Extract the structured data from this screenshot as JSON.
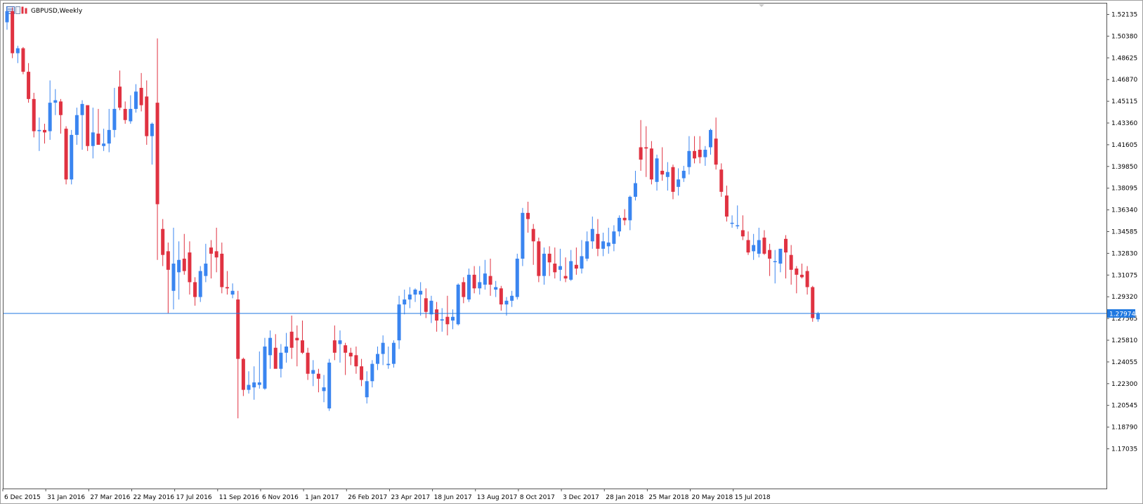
{
  "window": {
    "symbol_title": "GBPUSD,Weekly",
    "icons": [
      "chart-type-icon",
      "indicator-icon",
      "candle-icon"
    ]
  },
  "colors": {
    "bull": "#3a85f0",
    "bear": "#e03241",
    "current_price_line": "#1f78e0",
    "current_price_label_bg": "#1f78e0",
    "frame": "#888888"
  },
  "chart_data": {
    "type": "candlestick",
    "symbol": "GBPUSD",
    "timeframe": "Weekly",
    "current_price": 1.27974,
    "current_price_label": "1.27974",
    "ylim": [
      1.163,
      1.528
    ],
    "y_ticks": [
      "1.52135",
      "1.50380",
      "1.48625",
      "1.46870",
      "1.45115",
      "1.43360",
      "1.41605",
      "1.39850",
      "1.38095",
      "1.36340",
      "1.34585",
      "1.32830",
      "1.31075",
      "1.29320",
      "1.27565",
      "1.25810",
      "1.24055",
      "1.22300",
      "1.20545",
      "1.18790",
      "1.17035"
    ],
    "x_ticks": [
      {
        "index": 0,
        "label": "6 Dec 2015"
      },
      {
        "index": 8,
        "label": "31 Jan 2016"
      },
      {
        "index": 16,
        "label": "27 Mar 2016"
      },
      {
        "index": 24,
        "label": "22 May 2016"
      },
      {
        "index": 32,
        "label": "17 Jul 2016"
      },
      {
        "index": 40,
        "label": "11 Sep 2016"
      },
      {
        "index": 48,
        "label": "6 Nov 2016"
      },
      {
        "index": 56,
        "label": "1 Jan 2017"
      },
      {
        "index": 64,
        "label": "26 Feb 2017"
      },
      {
        "index": 72,
        "label": "23 Apr 2017"
      },
      {
        "index": 80,
        "label": "18 Jun 2017"
      },
      {
        "index": 88,
        "label": "13 Aug 2017"
      },
      {
        "index": 96,
        "label": "8 Oct 2017"
      },
      {
        "index": 104,
        "label": "3 Dec 2017"
      },
      {
        "index": 112,
        "label": "28 Jan 2018"
      },
      {
        "index": 120,
        "label": "25 Mar 2018"
      },
      {
        "index": 128,
        "label": "20 May 2018"
      },
      {
        "index": 136,
        "label": "15 Jul 2018"
      }
    ],
    "candles": [
      [
        1.515,
        1.528,
        1.509,
        1.524
      ],
      [
        1.524,
        1.527,
        1.486,
        1.49
      ],
      [
        1.49,
        1.496,
        1.482,
        1.494
      ],
      [
        1.494,
        1.495,
        1.473,
        1.475
      ],
      [
        1.475,
        1.482,
        1.45,
        1.453
      ],
      [
        1.453,
        1.458,
        1.422,
        1.427
      ],
      [
        1.427,
        1.438,
        1.411,
        1.428
      ],
      [
        1.428,
        1.433,
        1.417,
        1.426
      ],
      [
        1.427,
        1.468,
        1.42,
        1.45
      ],
      [
        1.45,
        1.461,
        1.44,
        1.452
      ],
      [
        1.451,
        1.453,
        1.425,
        1.44
      ],
      [
        1.429,
        1.431,
        1.384,
        1.388
      ],
      [
        1.388,
        1.428,
        1.384,
        1.424
      ],
      [
        1.424,
        1.446,
        1.416,
        1.44
      ],
      [
        1.44,
        1.452,
        1.412,
        1.449
      ],
      [
        1.448,
        1.448,
        1.411,
        1.415
      ],
      [
        1.415,
        1.446,
        1.405,
        1.426
      ],
      [
        1.425,
        1.445,
        1.417,
        1.416
      ],
      [
        1.415,
        1.429,
        1.411,
        1.417
      ],
      [
        1.417,
        1.445,
        1.41,
        1.428
      ],
      [
        1.428,
        1.462,
        1.422,
        1.445
      ],
      [
        1.463,
        1.476,
        1.444,
        1.446
      ],
      [
        1.445,
        1.451,
        1.433,
        1.436
      ],
      [
        1.435,
        1.456,
        1.433,
        1.445
      ],
      [
        1.445,
        1.465,
        1.442,
        1.459
      ],
      [
        1.462,
        1.474,
        1.443,
        1.448
      ],
      [
        1.455,
        1.468,
        1.416,
        1.423
      ],
      [
        1.423,
        1.434,
        1.4,
        1.433
      ],
      [
        1.45,
        1.502,
        1.323,
        1.368
      ],
      [
        1.348,
        1.356,
        1.318,
        1.327
      ],
      [
        1.33,
        1.337,
        1.28,
        1.315
      ],
      [
        1.298,
        1.349,
        1.283,
        1.32
      ],
      [
        1.313,
        1.338,
        1.291,
        1.323
      ],
      [
        1.324,
        1.344,
        1.311,
        1.314
      ],
      [
        1.329,
        1.338,
        1.295,
        1.305
      ],
      [
        1.305,
        1.309,
        1.286,
        1.293
      ],
      [
        1.293,
        1.318,
        1.289,
        1.314
      ],
      [
        1.31,
        1.336,
        1.305,
        1.32
      ],
      [
        1.333,
        1.339,
        1.308,
        1.328
      ],
      [
        1.33,
        1.349,
        1.313,
        1.325
      ],
      [
        1.328,
        1.337,
        1.296,
        1.301
      ],
      [
        1.301,
        1.314,
        1.295,
        1.3
      ],
      [
        1.295,
        1.304,
        1.292,
        1.298
      ],
      [
        1.291,
        1.298,
        1.195,
        1.243
      ],
      [
        1.243,
        1.244,
        1.213,
        1.218
      ],
      [
        1.218,
        1.233,
        1.215,
        1.222
      ],
      [
        1.22,
        1.237,
        1.21,
        1.224
      ],
      [
        1.222,
        1.249,
        1.219,
        1.224
      ],
      [
        1.219,
        1.26,
        1.218,
        1.253
      ],
      [
        1.246,
        1.266,
        1.235,
        1.26
      ],
      [
        1.252,
        1.263,
        1.238,
        1.235
      ],
      [
        1.235,
        1.255,
        1.228,
        1.248
      ],
      [
        1.248,
        1.264,
        1.24,
        1.253
      ],
      [
        1.265,
        1.278,
        1.243,
        1.252
      ],
      [
        1.26,
        1.27,
        1.237,
        1.258
      ],
      [
        1.258,
        1.274,
        1.247,
        1.248
      ],
      [
        1.248,
        1.252,
        1.226,
        1.231
      ],
      [
        1.231,
        1.242,
        1.221,
        1.234
      ],
      [
        1.231,
        1.235,
        1.216,
        1.227
      ],
      [
        1.217,
        1.23,
        1.208,
        1.22
      ],
      [
        1.203,
        1.243,
        1.201,
        1.24
      ],
      [
        1.258,
        1.27,
        1.242,
        1.248
      ],
      [
        1.255,
        1.266,
        1.24,
        1.258
      ],
      [
        1.254,
        1.256,
        1.23,
        1.248
      ],
      [
        1.248,
        1.252,
        1.238,
        1.245
      ],
      [
        1.246,
        1.253,
        1.231,
        1.237
      ],
      [
        1.237,
        1.243,
        1.221,
        1.226
      ],
      [
        1.212,
        1.233,
        1.207,
        1.225
      ],
      [
        1.225,
        1.242,
        1.22,
        1.239
      ],
      [
        1.239,
        1.253,
        1.234,
        1.247
      ],
      [
        1.247,
        1.262,
        1.238,
        1.256
      ],
      [
        1.238,
        1.253,
        1.235,
        1.239
      ],
      [
        1.239,
        1.258,
        1.236,
        1.256
      ],
      [
        1.258,
        1.294,
        1.251,
        1.287
      ],
      [
        1.287,
        1.299,
        1.279,
        1.291
      ],
      [
        1.291,
        1.301,
        1.284,
        1.295
      ],
      [
        1.295,
        1.3,
        1.289,
        1.299
      ],
      [
        1.295,
        1.305,
        1.278,
        1.298
      ],
      [
        1.292,
        1.3,
        1.276,
        1.281
      ],
      [
        1.279,
        1.294,
        1.272,
        1.29
      ],
      [
        1.283,
        1.289,
        1.265,
        1.274
      ],
      [
        1.274,
        1.284,
        1.265,
        1.275
      ],
      [
        1.277,
        1.294,
        1.262,
        1.271
      ],
      [
        1.274,
        1.283,
        1.267,
        1.277
      ],
      [
        1.271,
        1.304,
        1.27,
        1.303
      ],
      [
        1.305,
        1.309,
        1.288,
        1.293
      ],
      [
        1.291,
        1.316,
        1.289,
        1.311
      ],
      [
        1.311,
        1.318,
        1.296,
        1.3
      ],
      [
        1.3,
        1.318,
        1.295,
        1.305
      ],
      [
        1.303,
        1.323,
        1.299,
        1.312
      ],
      [
        1.31,
        1.324,
        1.294,
        1.303
      ],
      [
        1.299,
        1.306,
        1.293,
        1.301
      ],
      [
        1.3,
        1.302,
        1.282,
        1.287
      ],
      [
        1.287,
        1.293,
        1.278,
        1.29
      ],
      [
        1.29,
        1.298,
        1.285,
        1.294
      ],
      [
        1.293,
        1.328,
        1.291,
        1.324
      ],
      [
        1.324,
        1.365,
        1.318,
        1.361
      ],
      [
        1.361,
        1.37,
        1.345,
        1.356
      ],
      [
        1.348,
        1.352,
        1.319,
        1.338
      ],
      [
        1.338,
        1.341,
        1.305,
        1.31
      ],
      [
        1.31,
        1.333,
        1.303,
        1.328
      ],
      [
        1.328,
        1.334,
        1.31,
        1.321
      ],
      [
        1.32,
        1.333,
        1.308,
        1.313
      ],
      [
        1.315,
        1.332,
        1.306,
        1.318
      ],
      [
        1.31,
        1.325,
        1.305,
        1.308
      ],
      [
        1.307,
        1.331,
        1.306,
        1.322
      ],
      [
        1.319,
        1.333,
        1.311,
        1.316
      ],
      [
        1.316,
        1.339,
        1.312,
        1.326
      ],
      [
        1.324,
        1.346,
        1.322,
        1.338
      ],
      [
        1.338,
        1.358,
        1.332,
        1.348
      ],
      [
        1.344,
        1.356,
        1.326,
        1.332
      ],
      [
        1.332,
        1.345,
        1.326,
        1.338
      ],
      [
        1.334,
        1.349,
        1.328,
        1.337
      ],
      [
        1.336,
        1.351,
        1.33,
        1.346
      ],
      [
        1.346,
        1.359,
        1.342,
        1.357
      ],
      [
        1.357,
        1.364,
        1.351,
        1.355
      ],
      [
        1.355,
        1.375,
        1.347,
        1.374
      ],
      [
        1.374,
        1.395,
        1.371,
        1.385
      ],
      [
        1.414,
        1.436,
        1.395,
        1.404
      ],
      [
        1.414,
        1.431,
        1.39,
        1.413
      ],
      [
        1.413,
        1.419,
        1.384,
        1.388
      ],
      [
        1.386,
        1.408,
        1.379,
        1.405
      ],
      [
        1.395,
        1.414,
        1.387,
        1.392
      ],
      [
        1.39,
        1.402,
        1.379,
        1.394
      ],
      [
        1.398,
        1.4,
        1.372,
        1.378
      ],
      [
        1.382,
        1.397,
        1.375,
        1.388
      ],
      [
        1.389,
        1.399,
        1.386,
        1.395
      ],
      [
        1.398,
        1.423,
        1.392,
        1.411
      ],
      [
        1.411,
        1.423,
        1.401,
        1.405
      ],
      [
        1.412,
        1.423,
        1.401,
        1.406
      ],
      [
        1.406,
        1.415,
        1.399,
        1.412
      ],
      [
        1.414,
        1.429,
        1.408,
        1.428
      ],
      [
        1.421,
        1.438,
        1.396,
        1.4
      ],
      [
        1.396,
        1.401,
        1.374,
        1.378
      ],
      [
        1.375,
        1.383,
        1.354,
        1.358
      ],
      [
        1.353,
        1.359,
        1.349,
        1.353
      ],
      [
        1.351,
        1.367,
        1.348,
        1.351
      ],
      [
        1.347,
        1.359,
        1.339,
        1.342
      ],
      [
        1.339,
        1.346,
        1.327,
        1.329
      ],
      [
        1.33,
        1.344,
        1.323,
        1.335
      ],
      [
        1.328,
        1.349,
        1.325,
        1.339
      ],
      [
        1.341,
        1.347,
        1.327,
        1.328
      ],
      [
        1.331,
        1.336,
        1.31,
        1.324
      ],
      [
        1.322,
        1.331,
        1.304,
        1.322
      ],
      [
        1.32,
        1.331,
        1.313,
        1.332
      ],
      [
        1.34,
        1.343,
        1.308,
        1.329
      ],
      [
        1.327,
        1.335,
        1.303,
        1.315
      ],
      [
        1.316,
        1.318,
        1.296,
        1.311
      ],
      [
        1.311,
        1.32,
        1.308,
        1.309
      ],
      [
        1.314,
        1.318,
        1.295,
        1.301
      ],
      [
        1.301,
        1.302,
        1.273,
        1.276
      ],
      [
        1.275,
        1.281,
        1.273,
        1.2797
      ]
    ]
  }
}
